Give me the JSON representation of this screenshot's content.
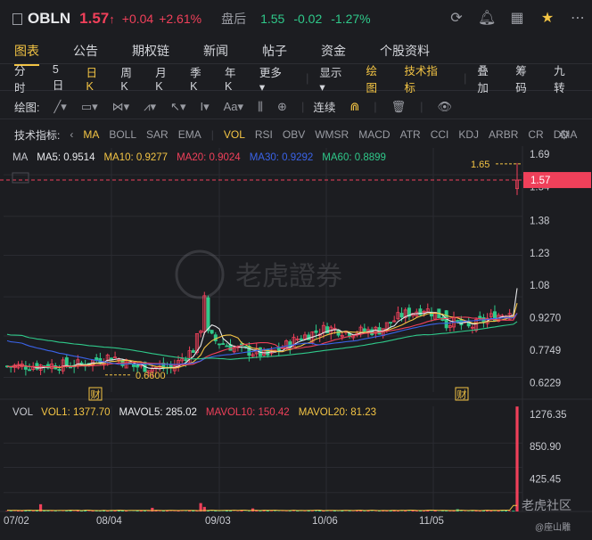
{
  "header": {
    "ticker": "OBLN",
    "price": "1.57",
    "change": "+0.04",
    "change_pct": "+2.61%",
    "after_label": "盘后",
    "after_price": "1.55",
    "after_change": "-0.02",
    "after_change_pct": "-1.27%",
    "icons": [
      "refresh-icon",
      "bell-icon",
      "grid-icon",
      "star-icon",
      "more-icon"
    ]
  },
  "tabs": [
    "图表",
    "公告",
    "期权链",
    "新闻",
    "帖子",
    "资金",
    "个股资料"
  ],
  "periods": {
    "items": [
      "分时",
      "5日",
      "日K",
      "周K",
      "月K",
      "季K",
      "年K",
      "更多 ▾"
    ],
    "selected": "日K",
    "right": [
      "显示 ▾",
      "绘图",
      "技术指标",
      "叠加",
      "筹码",
      "九转"
    ]
  },
  "drawing": {
    "label": "绘图:",
    "continuous": "连续"
  },
  "indicators": {
    "label": "技术指标:",
    "items": [
      "MA",
      "BOLL",
      "SAR",
      "EMA",
      "VOL",
      "RSI",
      "OBV",
      "WMSR",
      "MACD",
      "ATR",
      "CCI",
      "KDJ",
      "ARBR",
      "CR",
      "DMA"
    ],
    "active": [
      "MA",
      "VOL"
    ]
  },
  "ma_legend": [
    {
      "text": "MA",
      "color": "#c9cbd1"
    },
    {
      "text": "MA5: 0.9514",
      "color": "#e8e9ec"
    },
    {
      "text": "MA10: 0.9277",
      "color": "#f3c444"
    },
    {
      "text": "MA20: 0.9024",
      "color": "#f0405a"
    },
    {
      "text": "MA30: 0.9292",
      "color": "#3a63e8"
    },
    {
      "text": "MA60: 0.8899",
      "color": "#2fc98a"
    }
  ],
  "vol_legend": [
    {
      "text": "VOL",
      "color": "#c9cbd1"
    },
    {
      "text": "VOL1: 1377.70",
      "color": "#f3c444"
    },
    {
      "text": "MAVOL5: 285.02",
      "color": "#e8e9ec"
    },
    {
      "text": "MAVOL10: 150.42",
      "color": "#f0405a"
    },
    {
      "text": "MAVOL20: 81.23",
      "color": "#f3c444"
    }
  ],
  "chart_data": {
    "type": "candlestick",
    "price_axis_ticks": [
      "1.69",
      "1.54",
      "1.38",
      "1.23",
      "1.08",
      "0.9270",
      "0.7749",
      "0.6229"
    ],
    "volume_axis_ticks": [
      "1276.35",
      "850.90",
      "425.45"
    ],
    "x_labels": [
      "07/02",
      "08/04",
      "09/03",
      "10/06",
      "11/05"
    ],
    "current_price": "1.57",
    "high_marker": "1.65",
    "low_marker": "0.6600",
    "earnings_marker": "财",
    "price_range": [
      0.58,
      1.72
    ],
    "volume_range": [
      0,
      1380
    ]
  },
  "watermark": {
    "center": "老虎證券",
    "corner": "老虎社区",
    "author": "@座山雕"
  },
  "colors": {
    "up": "#f0405a",
    "down": "#2fc98a",
    "accent": "#f3c444",
    "bg": "#1c1d21"
  }
}
